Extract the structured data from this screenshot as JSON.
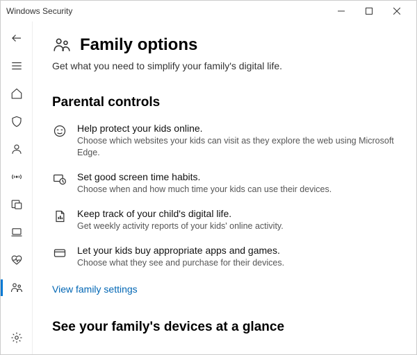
{
  "window": {
    "title": "Windows Security"
  },
  "sidebar": {
    "back": "Back",
    "menu": "Menu",
    "items": [
      {
        "name": "home"
      },
      {
        "name": "virus"
      },
      {
        "name": "account"
      },
      {
        "name": "firewall"
      },
      {
        "name": "app-browser"
      },
      {
        "name": "device-security"
      },
      {
        "name": "device-performance"
      },
      {
        "name": "family"
      }
    ],
    "settings": "Settings"
  },
  "page": {
    "title": "Family options",
    "subtitle": "Get what you need to simplify your family's digital life."
  },
  "parental": {
    "heading": "Parental controls",
    "items": [
      {
        "title": "Help protect your kids online.",
        "desc": "Choose which websites your kids can visit as they explore the web using Microsoft Edge."
      },
      {
        "title": "Set good screen time habits.",
        "desc": "Choose when and how much time your kids can use their devices."
      },
      {
        "title": "Keep track of your child's digital life.",
        "desc": "Get weekly activity reports of your kids' online activity."
      },
      {
        "title": "Let your kids buy appropriate apps and games.",
        "desc": "Choose what they see and purchase for their devices."
      }
    ],
    "link": "View family settings"
  },
  "devices": {
    "heading": "See your family's devices at a glance"
  }
}
